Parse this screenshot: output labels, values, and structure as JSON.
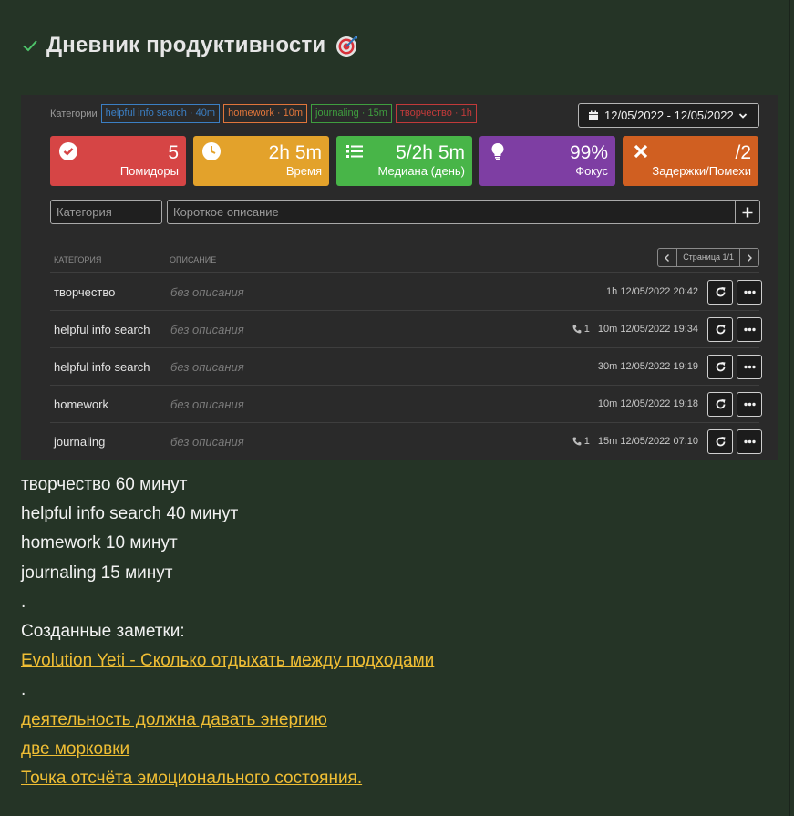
{
  "header": {
    "title": "Дневник продуктивности"
  },
  "categories": {
    "label": "Категории",
    "tags": [
      {
        "text": "helpful info search · 40m",
        "color": "#3b7fc4"
      },
      {
        "text": "homework · 10m",
        "color": "#e0753a"
      },
      {
        "text": "journaling · 15m",
        "color": "#3f9e3f"
      },
      {
        "text": "творчество · 1h",
        "color": "#c23a3a"
      }
    ]
  },
  "date_range": "12/05/2022 - 12/05/2022",
  "stats": [
    {
      "value": "5",
      "label": "Помидоры",
      "color": "#d64545",
      "icon": "check-circle-icon"
    },
    {
      "value": "2h 5m",
      "label": "Время",
      "color": "#e3a22b",
      "icon": "clock-icon"
    },
    {
      "value": "5/2h 5m",
      "label": "Медиана (день)",
      "color": "#48b548",
      "icon": "list-icon"
    },
    {
      "value": "99%",
      "label": "Фокус",
      "color": "#7e3ea3",
      "icon": "lightbulb-icon"
    },
    {
      "value": "/2",
      "label": "Задержки/Помехи",
      "color": "#d05f21",
      "icon": "x-icon"
    }
  ],
  "inputs": {
    "category_placeholder": "Категория",
    "description_placeholder": "Короткое описание"
  },
  "table": {
    "col_category": "КАТЕГОРИЯ",
    "col_description": "ОПИСАНИЕ",
    "pager_text": "Страница 1/1",
    "rows": [
      {
        "category": "творчество",
        "description": "без описания",
        "interruptions": "",
        "duration": "1h",
        "timestamp": "12/05/2022 20:42"
      },
      {
        "category": "helpful info search",
        "description": "без описания",
        "interruptions": "1",
        "duration": "10m",
        "timestamp": "12/05/2022 19:34"
      },
      {
        "category": "helpful info search",
        "description": "без описания",
        "interruptions": "",
        "duration": "30m",
        "timestamp": "12/05/2022 19:19"
      },
      {
        "category": "homework",
        "description": "без описания",
        "interruptions": "",
        "duration": "10m",
        "timestamp": "12/05/2022 19:18"
      },
      {
        "category": "journaling",
        "description": "без описания",
        "interruptions": "1",
        "duration": "15m",
        "timestamp": "12/05/2022 07:10"
      }
    ]
  },
  "notes": {
    "summary": [
      "творчество 60 минут",
      "helpful info search 40 минут",
      "homework 10 минут",
      "journaling 15 минут"
    ],
    "dot": ".",
    "created_label": "Созданные заметки:",
    "link_first": "Evolution Yeti - Сколько отдыхать между подходами",
    "links": [
      "деятельность должна давать энергию",
      "две морковки",
      "Точка отсчёта эмоционального состояния."
    ]
  }
}
